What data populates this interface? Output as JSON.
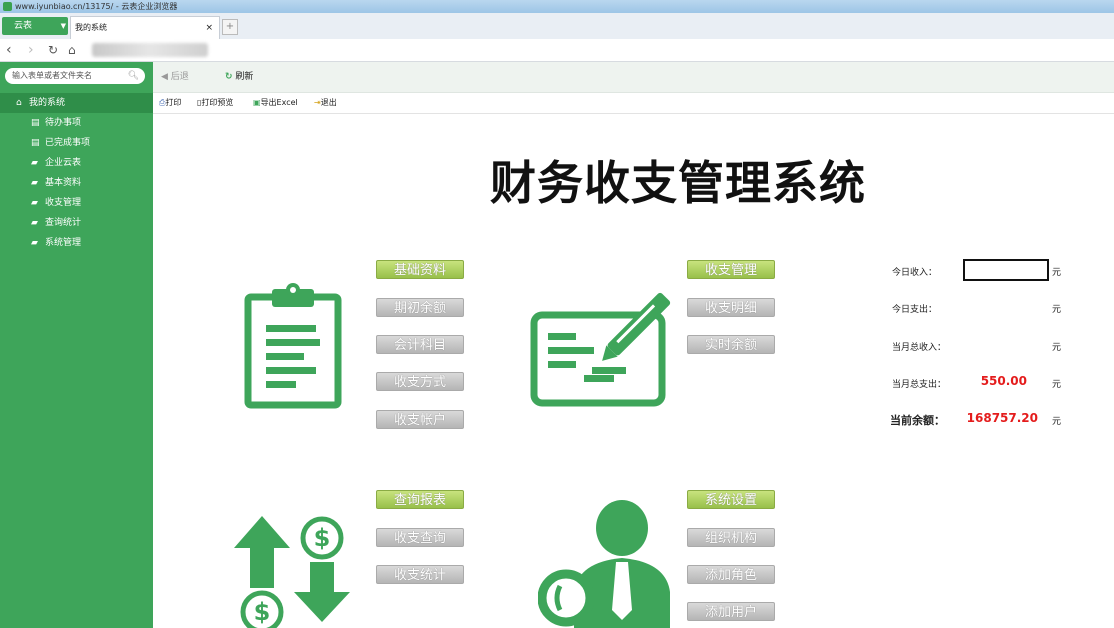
{
  "browser": {
    "title": "www.iyunbiao.cn/13175/ - 云表企业浏览器",
    "brand_label": "云表",
    "tab_label": "我的系统",
    "tab_close": "×"
  },
  "sidebar": {
    "search_placeholder": "输入表单或者文件夹名",
    "root_label": "我的系统",
    "items": [
      {
        "label": "待办事项",
        "icon": "document-icon"
      },
      {
        "label": "已完成事项",
        "icon": "document-icon"
      },
      {
        "label": "企业云表",
        "icon": "folder-icon"
      },
      {
        "label": "基本资料",
        "icon": "folder-icon"
      },
      {
        "label": "收支管理",
        "icon": "folder-icon"
      },
      {
        "label": "查询统计",
        "icon": "folder-icon"
      },
      {
        "label": "系统管理",
        "icon": "folder-icon"
      }
    ]
  },
  "toolbar": {
    "back": "后退",
    "refresh": "刷新",
    "print": "打印",
    "print_preview": "打印预览",
    "export_excel": "导出Excel",
    "exit": "退出"
  },
  "main": {
    "title": "财务收支管理系统",
    "groups": {
      "basic": [
        "基础资料",
        "期初余额",
        "会计科目",
        "收支方式",
        "收支帐户"
      ],
      "manage": [
        "收支管理",
        "收支明细",
        "实时余额"
      ],
      "query": [
        "查询报表",
        "收支查询",
        "收支统计"
      ],
      "system": [
        "系统设置",
        "组织机构",
        "添加角色",
        "添加用户"
      ]
    }
  },
  "stats": {
    "today_income_label": "今日收入：",
    "today_expense_label": "今日支出：",
    "month_income_label": "当月总收入：",
    "month_expense_label": "当月总支出：",
    "month_expense_value": "550.00",
    "balance_label": "当前余额：",
    "balance_value": "168757.20",
    "unit": "元"
  },
  "colors": {
    "brand_green": "#3ea55a",
    "highlight_button": "#a8cd5b",
    "value_red": "#e41c1c"
  }
}
